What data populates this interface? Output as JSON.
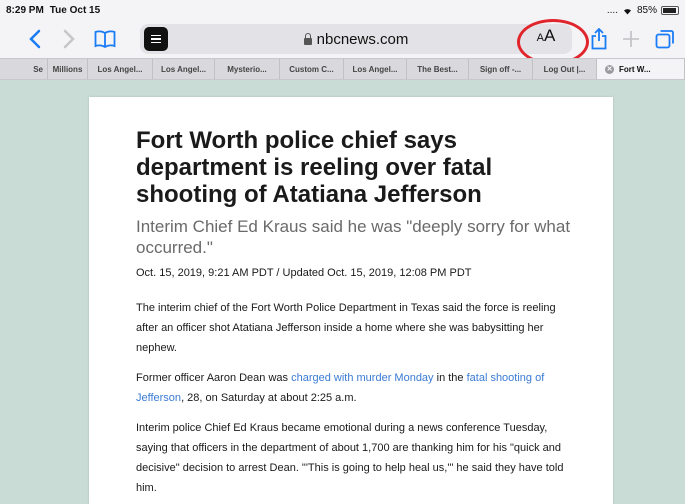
{
  "status": {
    "time": "8:29 PM",
    "date": "Tue Oct 15",
    "signal": "....",
    "battery": "85%"
  },
  "toolbar": {
    "back": "‹",
    "forward": "›",
    "url": "nbcnews.com",
    "aa_small": "A",
    "aa_big": "A"
  },
  "tabs": [
    "Se",
    "Millions",
    "Los Angel...",
    "Los Angel...",
    "Mysterio...",
    "Custom C...",
    "Los Angel...",
    "The Best...",
    "Sign off -...",
    "Log Out |...",
    "Fort W..."
  ],
  "article": {
    "headline": "Fort Worth police chief says department is reeling over fatal shooting of Atatiana Jefferson",
    "subhead": "Interim Chief Ed Kraus said he was \"deeply sorry for what occurred.\"",
    "dateline": "Oct. 15, 2019, 9:21 AM PDT / Updated Oct. 15, 2019, 12:08 PM PDT",
    "p1": "The interim chief of the Fort Worth Police Department in Texas said the force is reeling after an officer shot Atatiana Jefferson inside a home where she was babysitting her nephew.",
    "p2": {
      "a": "Former officer Aaron Dean was ",
      "link1": "charged with murder Monday",
      "b": " in the ",
      "link2": "fatal shooting of Jefferson",
      "c": ", 28, on Saturday at about 2:25 a.m."
    },
    "p3": "Interim police Chief Ed Kraus became emotional during a news conference Tuesday, saying that officers in the department of about 1,700 are thanking him for his \"quick and decisive\" decision to arrest Dean. \"'This is going to help heal us,'\" he said they have told him."
  },
  "colors": {
    "accent": "#1a7cf5",
    "link": "#3a7bd5",
    "highlight_circle": "#e0262c"
  }
}
